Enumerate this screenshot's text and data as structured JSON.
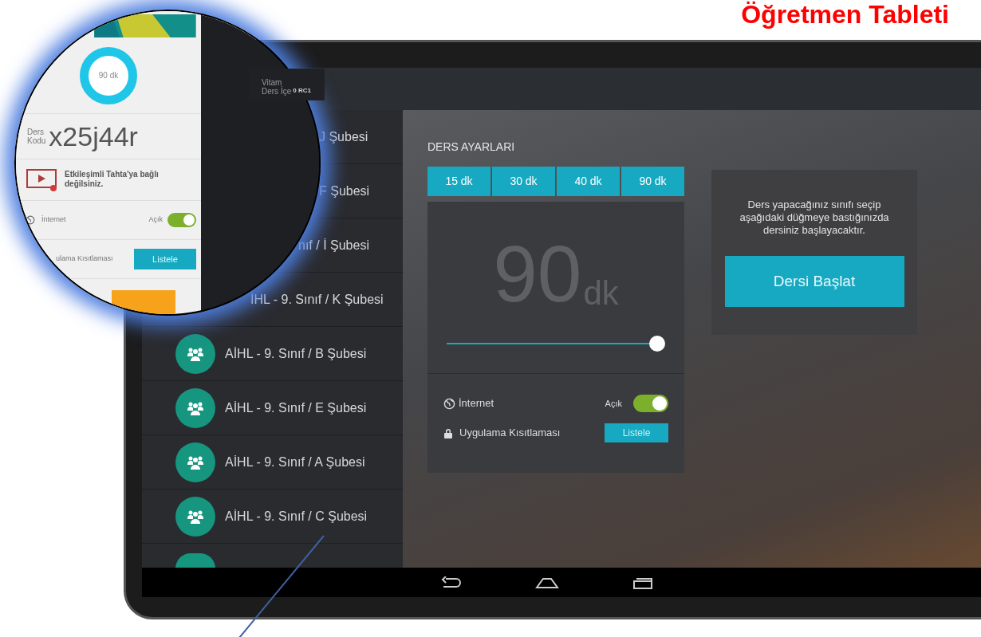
{
  "title": "Öğretmen Tableti",
  "tooltip": {
    "lines": [
      "Vitam",
      "Ders İçe"
    ],
    "version": "0 RC1"
  },
  "classes": [
    {
      "kind": "partial",
      "label": "J Şubesi"
    },
    {
      "kind": "partial",
      "label": "F Şubesi"
    },
    {
      "kind": "partial",
      "label": "nıf / İ Şubesi"
    },
    {
      "kind": "partial",
      "label": "İHL - 9. Sınıf / K Şubesi"
    },
    {
      "kind": "full",
      "label": "AİHL - 9. Sınıf / B Şubesi"
    },
    {
      "kind": "full",
      "label": "AİHL - 9. Sınıf / E Şubesi"
    },
    {
      "kind": "full",
      "label": "AİHL - 9. Sınıf / A Şubesi"
    },
    {
      "kind": "full",
      "label": "AİHL - 9. Sınıf / C Şubesi"
    },
    {
      "kind": "cutoff"
    }
  ],
  "settings": {
    "title": "DERS AYARLARI",
    "durations": [
      "15 dk",
      "30 dk",
      "40 dk",
      "90 dk"
    ],
    "big_value": "90",
    "big_unit": "dk",
    "slider": {
      "level": 1
    },
    "internet": {
      "label": "İnternet",
      "state_text": "Açık",
      "on": true
    },
    "restriction": {
      "label": "Uygulama Kısıtlaması",
      "button": "Listele"
    }
  },
  "start_card": {
    "text": "Ders yapacağınız sınıfı seçip aşağıdaki düğmeye bastığınızda dersiniz başlayacaktır.",
    "button": "Dersi Başlat"
  },
  "magnifier": {
    "timer": "90 dk",
    "code_label": [
      "Ders",
      "Kodu"
    ],
    "code": "x25j44r",
    "board_status": "Etkileşimli Tahta'ya bağlı değilsiniz.",
    "internet_label": "İnternet",
    "internet_state": "Açık",
    "internet_on": true,
    "restriction_label": "ulama Kısıtlaması",
    "list_button": "Listele"
  }
}
